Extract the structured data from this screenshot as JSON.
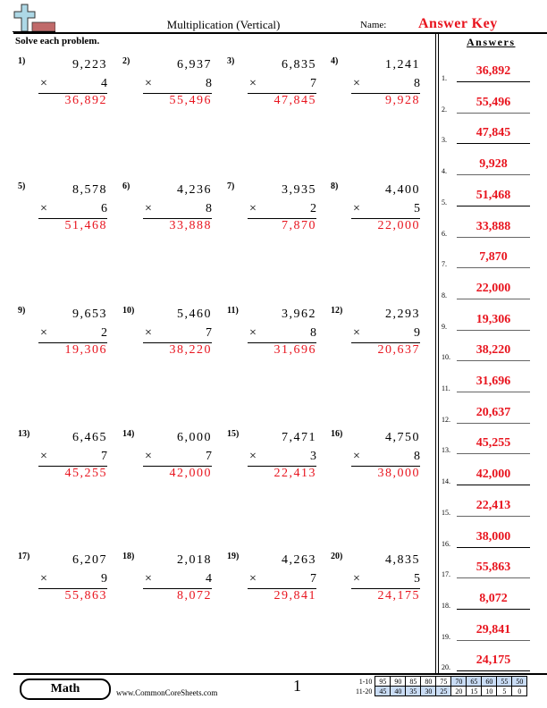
{
  "header": {
    "title": "Multiplication (Vertical)",
    "name_label": "Name:",
    "name_value": "Answer Key",
    "instructions": "Solve each problem.",
    "logo_icon": "plus-eraser-logo-icon"
  },
  "answers_heading": "Answers",
  "operator_symbol": "×",
  "problems": [
    {
      "num": "1)",
      "top": "9,223",
      "multiplier": "4",
      "result": "36,892"
    },
    {
      "num": "2)",
      "top": "6,937",
      "multiplier": "8",
      "result": "55,496"
    },
    {
      "num": "3)",
      "top": "6,835",
      "multiplier": "7",
      "result": "47,845"
    },
    {
      "num": "4)",
      "top": "1,241",
      "multiplier": "8",
      "result": "9,928"
    },
    {
      "num": "5)",
      "top": "8,578",
      "multiplier": "6",
      "result": "51,468"
    },
    {
      "num": "6)",
      "top": "4,236",
      "multiplier": "8",
      "result": "33,888"
    },
    {
      "num": "7)",
      "top": "3,935",
      "multiplier": "2",
      "result": "7,870"
    },
    {
      "num": "8)",
      "top": "4,400",
      "multiplier": "5",
      "result": "22,000"
    },
    {
      "num": "9)",
      "top": "9,653",
      "multiplier": "2",
      "result": "19,306"
    },
    {
      "num": "10)",
      "top": "5,460",
      "multiplier": "7",
      "result": "38,220"
    },
    {
      "num": "11)",
      "top": "3,962",
      "multiplier": "8",
      "result": "31,696"
    },
    {
      "num": "12)",
      "top": "2,293",
      "multiplier": "9",
      "result": "20,637"
    },
    {
      "num": "13)",
      "top": "6,465",
      "multiplier": "7",
      "result": "45,255"
    },
    {
      "num": "14)",
      "top": "6,000",
      "multiplier": "7",
      "result": "42,000"
    },
    {
      "num": "15)",
      "top": "7,471",
      "multiplier": "3",
      "result": "22,413"
    },
    {
      "num": "16)",
      "top": "4,750",
      "multiplier": "8",
      "result": "38,000"
    },
    {
      "num": "17)",
      "top": "6,207",
      "multiplier": "9",
      "result": "55,863"
    },
    {
      "num": "18)",
      "top": "2,018",
      "multiplier": "4",
      "result": "8,072"
    },
    {
      "num": "19)",
      "top": "4,263",
      "multiplier": "7",
      "result": "29,841"
    },
    {
      "num": "20)",
      "top": "4,835",
      "multiplier": "5",
      "result": "24,175"
    }
  ],
  "answers": [
    {
      "num": "1.",
      "value": "36,892"
    },
    {
      "num": "2.",
      "value": "55,496"
    },
    {
      "num": "3.",
      "value": "47,845"
    },
    {
      "num": "4.",
      "value": "9,928"
    },
    {
      "num": "5.",
      "value": "51,468"
    },
    {
      "num": "6.",
      "value": "33,888"
    },
    {
      "num": "7.",
      "value": "7,870"
    },
    {
      "num": "8.",
      "value": "22,000"
    },
    {
      "num": "9.",
      "value": "19,306"
    },
    {
      "num": "10.",
      "value": "38,220"
    },
    {
      "num": "11.",
      "value": "31,696"
    },
    {
      "num": "12.",
      "value": "20,637"
    },
    {
      "num": "13.",
      "value": "45,255"
    },
    {
      "num": "14.",
      "value": "42,000"
    },
    {
      "num": "15.",
      "value": "22,413"
    },
    {
      "num": "16.",
      "value": "38,000"
    },
    {
      "num": "17.",
      "value": "55,863"
    },
    {
      "num": "18.",
      "value": "8,072"
    },
    {
      "num": "19.",
      "value": "29,841"
    },
    {
      "num": "20.",
      "value": "24,175"
    }
  ],
  "footer": {
    "subject": "Math",
    "site": "www.CommonCoreSheets.com",
    "page": "1",
    "score_rows": [
      {
        "label": "1-10",
        "cells": [
          "95",
          "90",
          "85",
          "80",
          "75",
          "70",
          "65",
          "60",
          "55",
          "50"
        ]
      },
      {
        "label": "11-20",
        "cells": [
          "45",
          "40",
          "35",
          "30",
          "25",
          "20",
          "15",
          "10",
          "5",
          "0"
        ]
      }
    ],
    "highlight_color": "#c9dcf5"
  },
  "colors": {
    "answer_red": "#e8141e"
  }
}
